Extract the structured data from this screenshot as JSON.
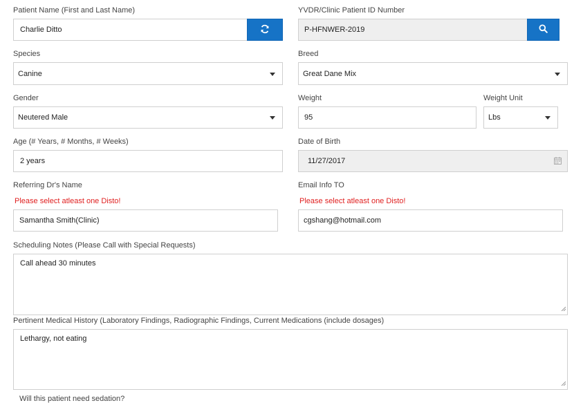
{
  "patient_name": {
    "label": "Patient Name (First and Last Name)",
    "value": "Charlie Ditto"
  },
  "patient_id": {
    "label": "YVDR/Clinic Patient ID Number",
    "value": "P-HFNWER-2019"
  },
  "species": {
    "label": "Species",
    "value": "Canine"
  },
  "breed": {
    "label": "Breed",
    "value": "Great Dane Mix"
  },
  "gender": {
    "label": "Gender",
    "value": "Neutered Male"
  },
  "weight": {
    "label": "Weight",
    "value": "95"
  },
  "weight_unit": {
    "label": "Weight Unit",
    "value": "Lbs"
  },
  "age": {
    "label": "Age (# Years, # Months, # Weeks)",
    "value": "2 years"
  },
  "dob": {
    "label": "Date of Birth",
    "value": "11/27/2017"
  },
  "referring_dr": {
    "label": "Referring Dr's Name",
    "error": "Please select atleast one Disto!",
    "value": "Samantha Smith(Clinic)"
  },
  "email_info": {
    "label": "Email Info TO",
    "error": "Please select atleast one Disto!",
    "value": "cgshang@hotmail.com"
  },
  "scheduling_notes": {
    "label": "Scheduling Notes (Please Call with Special Requests)",
    "value": "Call ahead 30 minutes"
  },
  "medical_history": {
    "label": "Pertinent Medical History (Laboratory Findings, Radiographic Findings, Current Medications (include dosages)",
    "value": "Lethargy, not eating"
  },
  "next_question": {
    "label": "Will this patient need sedation?"
  },
  "icons": {
    "refresh": "refresh-icon",
    "search": "search-icon",
    "calendar": "calendar-icon",
    "dropdown": "chevron-down-icon",
    "resize": "resize-grip-icon"
  },
  "colors": {
    "primary_button": "#1673c6",
    "error_text": "#e02020",
    "readonly_bg": "#efefef",
    "border": "#cfcfcf"
  }
}
